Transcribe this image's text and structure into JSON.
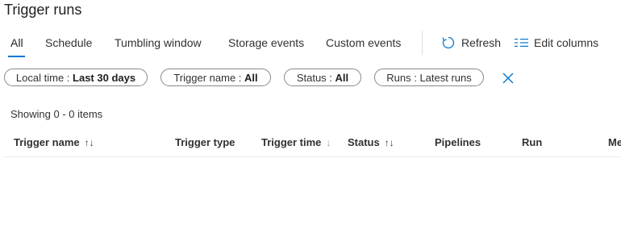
{
  "page": {
    "title": "Trigger runs"
  },
  "tabs": [
    {
      "label": "All",
      "active": true
    },
    {
      "label": "Schedule"
    },
    {
      "label": "Tumbling window"
    },
    {
      "label": "Storage events"
    },
    {
      "label": "Custom events"
    }
  ],
  "toolbar": {
    "refresh_label": "Refresh",
    "edit_columns_label": "Edit columns"
  },
  "filters": [
    {
      "key": "Local time : ",
      "value": "Last 30 days"
    },
    {
      "key": "Trigger name : ",
      "value": "All"
    },
    {
      "key": "Status : ",
      "value": "All"
    },
    {
      "key": "Runs : ",
      "value": "Latest runs"
    }
  ],
  "results": {
    "summary": "Showing 0 - 0 items"
  },
  "table": {
    "columns": [
      {
        "label": "Trigger name",
        "sort": "↑↓"
      },
      {
        "label": "Trigger type"
      },
      {
        "label": "Trigger time",
        "sort": "↓"
      },
      {
        "label": "Status",
        "sort": "↑↓"
      },
      {
        "label": "Pipelines"
      },
      {
        "label": "Run"
      },
      {
        "label": "Me"
      }
    ]
  },
  "colors": {
    "accent": "#0078d4",
    "border": "#8a8886",
    "text": "#323130"
  }
}
